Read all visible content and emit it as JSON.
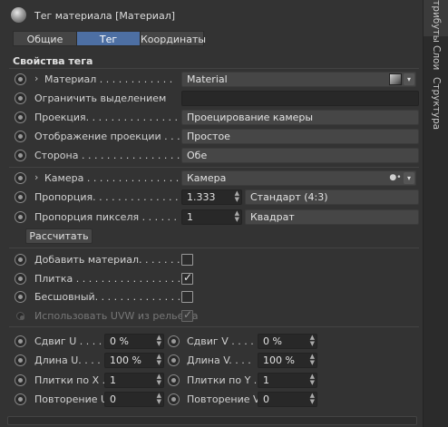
{
  "header": {
    "title": "Тег материала [Материал]"
  },
  "tabs": [
    {
      "label": "Общие",
      "active": false
    },
    {
      "label": "Тег",
      "active": true
    },
    {
      "label": "Координаты",
      "active": false
    }
  ],
  "sidebar_tabs": [
    {
      "label": "Атрибуты"
    },
    {
      "label": "Слои"
    },
    {
      "label": "Структура"
    }
  ],
  "section_title": "Свойства тега",
  "fields": {
    "material": {
      "label": "Материал . . . . . . . . . . . .",
      "value": "Material"
    },
    "restrict": {
      "label": "Ограничить выделением",
      "value": ""
    },
    "projection": {
      "label": "Проекция. . . . . . . . . . . . . . .",
      "value": "Проецирование камеры"
    },
    "proj_display": {
      "label": "Отображение проекции . . . .",
      "value": "Простое"
    },
    "side": {
      "label": "Сторона . . . . . . . . . . . . . . . .",
      "value": "Обе"
    },
    "camera": {
      "label": "Камера . . . . . . . . . . . . . . .",
      "value": "Камера"
    },
    "aspect": {
      "label": "Пропорция. . . . . . . . . . . . . .",
      "value": "1.333",
      "preset": "Стандарт (4:3)"
    },
    "pixel_aspect": {
      "label": "Пропорция пикселя . . . . . .",
      "value": "1",
      "preset": "Квадрат"
    },
    "calc_button": "Рассчитать",
    "add_material": {
      "label": "Добавить материал. . . . . . . .",
      "checked": false
    },
    "tile": {
      "label": "Плитка . . . . . . . . . . . . . . . . .",
      "checked": true
    },
    "seamless": {
      "label": "Бесшовный. . . . . . . . . . . . . .",
      "checked": false
    },
    "use_uvw": {
      "label": "Использовать UVW из рельефа",
      "checked": true
    }
  },
  "offsets": {
    "offset_u": {
      "label": "Сдвиг U . . . .",
      "value": "0 %"
    },
    "offset_v": {
      "label": "Сдвиг V . . . .",
      "value": "0 %"
    },
    "length_u": {
      "label": "Длина U. . . .",
      "value": "100 %"
    },
    "length_v": {
      "label": "Длина V. . . .",
      "value": "100 %"
    },
    "tiles_x": {
      "label": "Плитки по X .",
      "value": "1"
    },
    "tiles_y": {
      "label": "Плитки по Y .",
      "value": "1"
    },
    "repeat_u": {
      "label": "Повторение U",
      "value": "0"
    },
    "repeat_v": {
      "label": "Повторение V",
      "value": "0"
    }
  },
  "colors": {
    "accent": "#4d6fa3",
    "panel": "#333333"
  }
}
